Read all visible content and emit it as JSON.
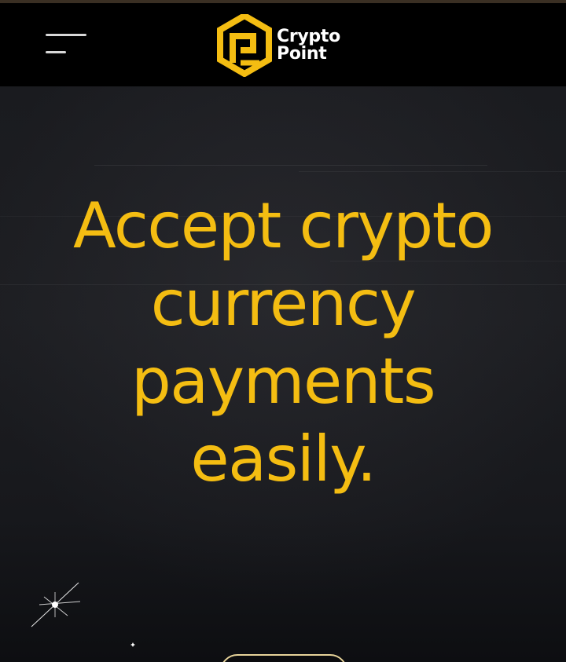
{
  "header": {
    "menu_icon": "hamburger-menu-icon",
    "logo": {
      "icon": "crypto-point-logo-mark",
      "line1": "Crypto",
      "line2": "Point"
    }
  },
  "hero": {
    "headline": "Accept crypto currency payments easily."
  },
  "colors": {
    "accent": "#f4bd12",
    "header_bg": "#000000",
    "hero_bg": "#1c1d21",
    "text_light": "#ffffff"
  }
}
